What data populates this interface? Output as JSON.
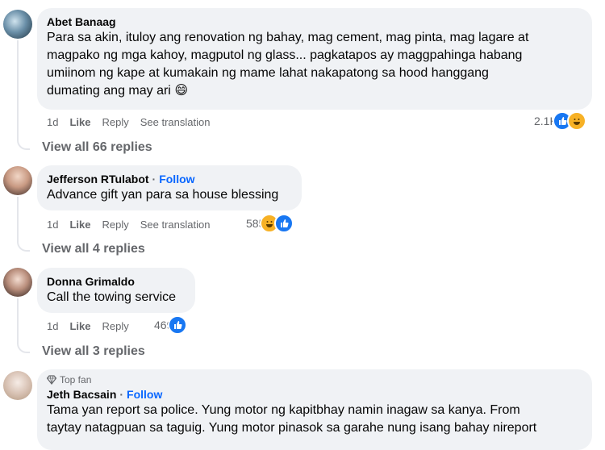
{
  "comments": [
    {
      "author": "Abet Banaag",
      "text_lines": [
        "Para sa akin, ituloy ang renovation ng bahay, mag cement, mag pinta, mag lagare at",
        "magpako ng mga kahoy, magputol ng glass... pagkatapos ay maggpahinga habang",
        "umiinom ng kape at kumakain ng mame lahat nakapatong sa hood hanggang",
        "dumating ang may ari"
      ],
      "emoji": "😄",
      "time": "1d",
      "like": "Like",
      "reply": "Reply",
      "translate": "See translation",
      "reaction_count": "2.1K",
      "view_replies": "View all 66 replies"
    },
    {
      "author": "Jefferson RTulabot",
      "follow": "Follow",
      "dot": "·",
      "text": "Advance gift yan para sa house blessing",
      "time": "1d",
      "like": "Like",
      "reply": "Reply",
      "translate": "See translation",
      "reaction_count": "585",
      "view_replies": "View all 4 replies"
    },
    {
      "author": "Donna Grimaldo",
      "text": "Call the towing service",
      "time": "1d",
      "like": "Like",
      "reply": "Reply",
      "reaction_count": "469",
      "view_replies": "View all 3 replies"
    },
    {
      "badge": "Top fan",
      "author": "Jeth Bacsain",
      "follow": "Follow",
      "dot": "·",
      "text_lines": [
        "Tama yan report sa police. Yung motor ng kapitbhay namin inagaw sa kanya. From",
        "taytay natagpuan sa taguig. Yung motor pinasok sa garahe nung isang bahay nireport"
      ]
    }
  ],
  "colors": {
    "bubble": "#f0f2f5",
    "follow": "#0866ff",
    "secondary": "#65676b",
    "like": "#1877f2",
    "haha": "#f7b125"
  },
  "icons": [
    "like-icon",
    "haha-icon",
    "diamond-icon"
  ]
}
